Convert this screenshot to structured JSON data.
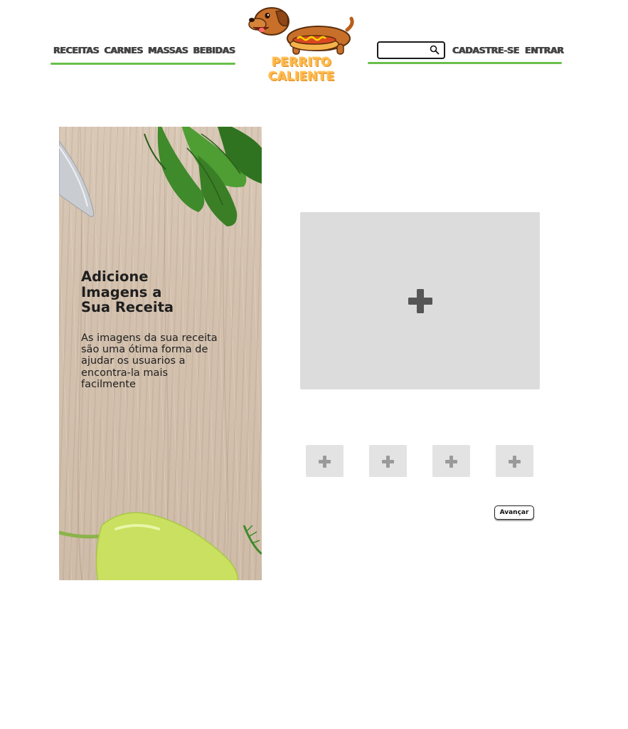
{
  "header": {
    "nav": [
      {
        "label": "RECEITAS"
      },
      {
        "label": "CARNES"
      },
      {
        "label": "MASSAS"
      },
      {
        "label": "BEBIDAS"
      }
    ],
    "logo_text": "PERRITO CALIENTE",
    "search": {
      "value": "",
      "placeholder": ""
    },
    "signup_label": "CADASTRE-SE",
    "login_label": "ENTRAR",
    "accent_color": "#6abf4b"
  },
  "banner": {
    "title": "Adicione\nImagens a\nSua Receita",
    "body": "As imagens da sua receita são uma ótima forma de ajudar os usuarios a encontra-la mais facilmente"
  },
  "upload": {
    "main_icon": "plus-icon",
    "thumb_icon": "plus-icon",
    "thumb_count": 4
  },
  "actions": {
    "next_label": "Avançar"
  }
}
